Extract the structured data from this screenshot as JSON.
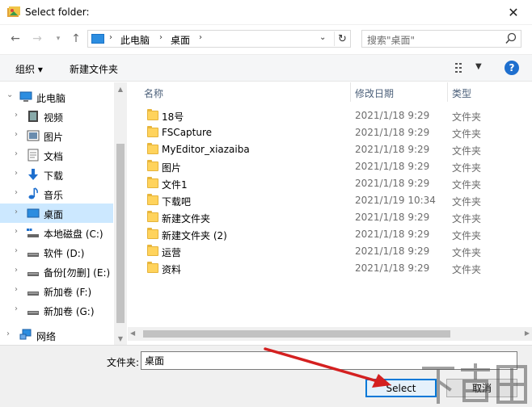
{
  "window": {
    "title": "Select folder:"
  },
  "nav": {
    "breadcrumb": [
      "此电脑",
      "桌面"
    ]
  },
  "search": {
    "placeholder": "搜索\"桌面\""
  },
  "toolbar": {
    "organize": "组织 ▾",
    "new_folder": "新建文件夹"
  },
  "sidebar": {
    "items": [
      {
        "label": "此电脑",
        "icon": "computer-icon",
        "expanded": true
      },
      {
        "label": "视频",
        "icon": "video-icon"
      },
      {
        "label": "图片",
        "icon": "pictures-icon"
      },
      {
        "label": "文档",
        "icon": "documents-icon"
      },
      {
        "label": "下载",
        "icon": "download-icon"
      },
      {
        "label": "音乐",
        "icon": "music-icon"
      },
      {
        "label": "桌面",
        "icon": "desktop-icon",
        "selected": true
      },
      {
        "label": "本地磁盘 (C:)",
        "icon": "system-drive-icon"
      },
      {
        "label": "软件 (D:)",
        "icon": "drive-icon"
      },
      {
        "label": "备份[勿删] (E:)",
        "icon": "drive-icon"
      },
      {
        "label": "新加卷 (F:)",
        "icon": "drive-icon"
      },
      {
        "label": "新加卷 (G:)",
        "icon": "drive-icon"
      },
      {
        "label": "网络",
        "icon": "network-icon"
      }
    ]
  },
  "filelist": {
    "columns": {
      "name": "名称",
      "date": "修改日期",
      "type": "类型"
    },
    "rows": [
      {
        "name": "18号",
        "date": "2021/1/18 9:29",
        "type": "文件夹"
      },
      {
        "name": "FSCapture",
        "date": "2021/1/18 9:29",
        "type": "文件夹"
      },
      {
        "name": "MyEditor_xiazaiba",
        "date": "2021/1/18 9:29",
        "type": "文件夹"
      },
      {
        "name": "图片",
        "date": "2021/1/18 9:29",
        "type": "文件夹"
      },
      {
        "name": "文件1",
        "date": "2021/1/18 9:29",
        "type": "文件夹"
      },
      {
        "name": "下载吧",
        "date": "2021/1/19 10:34",
        "type": "文件夹"
      },
      {
        "name": "新建文件夹",
        "date": "2021/1/18 9:29",
        "type": "文件夹"
      },
      {
        "name": "新建文件夹 (2)",
        "date": "2021/1/18 9:29",
        "type": "文件夹"
      },
      {
        "name": "运营",
        "date": "2021/1/18 9:29",
        "type": "文件夹"
      },
      {
        "name": "资料",
        "date": "2021/1/18 9:29",
        "type": "文件夹"
      }
    ]
  },
  "footer": {
    "folder_label": "文件夹:",
    "folder_value": "桌面",
    "select_label": "Select",
    "cancel_label": "取消"
  },
  "colors": {
    "accent": "#0078d7",
    "selected_bg": "#cce8ff",
    "annotation_arrow": "#d42020"
  }
}
